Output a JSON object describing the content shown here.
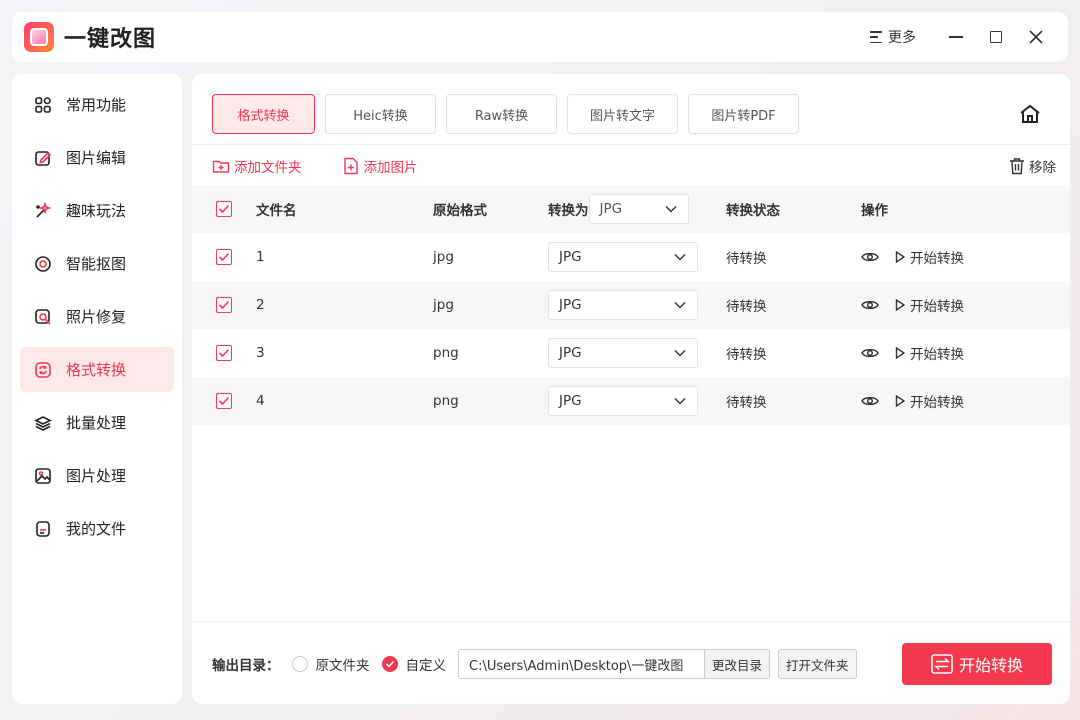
{
  "app": {
    "title": "一键改图",
    "more_label": "更多"
  },
  "sidebar": {
    "items": [
      {
        "label": "常用功能",
        "icon": "grid-icon"
      },
      {
        "label": "图片编辑",
        "icon": "edit-icon"
      },
      {
        "label": "趣味玩法",
        "icon": "sparkle-icon"
      },
      {
        "label": "智能抠图",
        "icon": "target-icon"
      },
      {
        "label": "照片修复",
        "icon": "repair-icon"
      },
      {
        "label": "格式转换",
        "icon": "convert-icon",
        "active": true
      },
      {
        "label": "批量处理",
        "icon": "layers-icon"
      },
      {
        "label": "图片处理",
        "icon": "image-icon"
      },
      {
        "label": "我的文件",
        "icon": "file-icon"
      }
    ]
  },
  "tabs": [
    {
      "label": "格式转换",
      "active": true
    },
    {
      "label": "Heic转换"
    },
    {
      "label": "Raw转换"
    },
    {
      "label": "图片转文字"
    },
    {
      "label": "图片转PDF"
    }
  ],
  "toolbar": {
    "add_folder": "添加文件夹",
    "add_image": "添加图片",
    "remove": "移除"
  },
  "table": {
    "headers": {
      "name": "文件名",
      "format": "原始格式",
      "convert_to": "转换为",
      "status": "转换状态",
      "action": "操作"
    },
    "global_target": "JPG",
    "rows": [
      {
        "name": "1",
        "format": "jpg",
        "target": "JPG",
        "status": "待转换",
        "action": "开始转换"
      },
      {
        "name": "2",
        "format": "jpg",
        "target": "JPG",
        "status": "待转换",
        "action": "开始转换"
      },
      {
        "name": "3",
        "format": "png",
        "target": "JPG",
        "status": "待转换",
        "action": "开始转换"
      },
      {
        "name": "4",
        "format": "png",
        "target": "JPG",
        "status": "待转换",
        "action": "开始转换"
      }
    ]
  },
  "footer": {
    "output_label": "输出目录：",
    "option_original": "原文件夹",
    "option_custom": "自定义",
    "selected_option": "custom",
    "path": "C:\\Users\\Admin\\Desktop\\一键改图",
    "change_dir": "更改目录",
    "open_folder": "打开文件夹",
    "start_button": "开始转换"
  },
  "colors": {
    "accent": "#f0384f",
    "accent_light": "#fde8ea"
  }
}
